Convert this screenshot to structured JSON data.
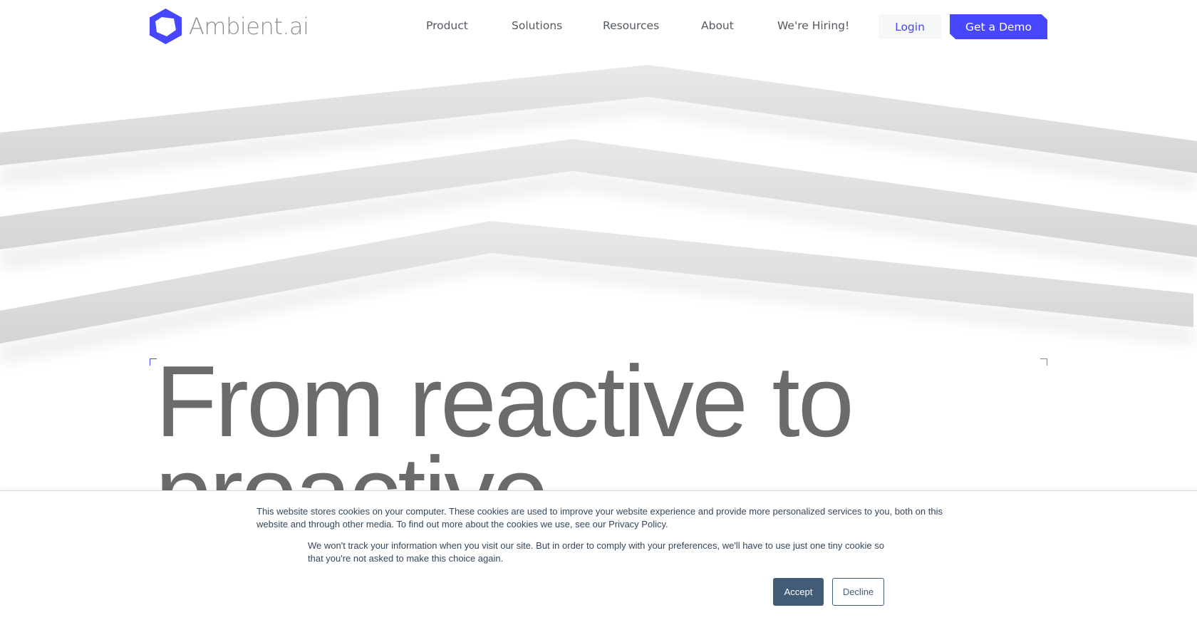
{
  "header": {
    "logo_text": "Ambient.ai",
    "brand_color": "#4747ff",
    "nav": [
      "Product",
      "Solutions",
      "Resources",
      "About",
      "We're Hiring!"
    ],
    "login_label": "Login",
    "demo_label": "Get a Demo"
  },
  "hero": {
    "line1": "From reactive to",
    "line2": "proactive"
  },
  "cookie_banner": {
    "text1": "This website stores cookies on your computer. These cookies are used to improve your website experience and provide more personalized services to you, both on this website and through other media. To find out more about the cookies we use, see our Privacy Policy.",
    "text2": "We won't track your information when you visit our site. But in order to comply with your preferences, we'll have to use just one tiny cookie so that you're not asked to make this choice again.",
    "accept_label": "Accept",
    "decline_label": "Decline",
    "button_color": "#425b76"
  }
}
